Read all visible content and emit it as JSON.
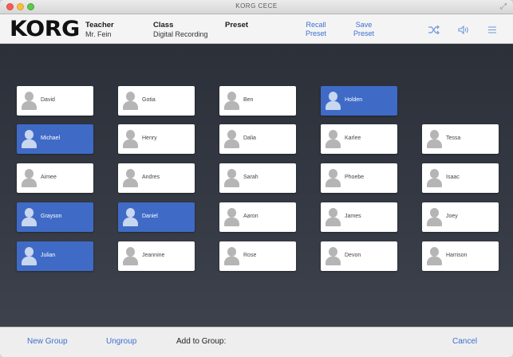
{
  "window": {
    "title": "KORG CECE"
  },
  "header": {
    "logo": "KORG",
    "teacher_label": "Teacher",
    "teacher_value": "Mr. Fein",
    "class_label": "Class",
    "class_value": "Digital Recording",
    "preset_label": "Preset",
    "recall_preset_line1": "Recall",
    "recall_preset_line2": "Preset",
    "save_preset_line1": "Save",
    "save_preset_line2": "Preset",
    "icons": [
      "shuffle-icon",
      "speaker-icon",
      "menu-icon"
    ]
  },
  "students": [
    {
      "name": "David",
      "selected": false
    },
    {
      "name": "Michael",
      "selected": true
    },
    {
      "name": "Aimee",
      "selected": false
    },
    {
      "name": "Grayson",
      "selected": true
    },
    {
      "name": "Julian",
      "selected": true
    },
    {
      "name": "Gotia",
      "selected": false
    },
    {
      "name": "Henry",
      "selected": false
    },
    {
      "name": "Andres",
      "selected": false
    },
    {
      "name": "Daniel",
      "selected": true
    },
    {
      "name": "Jeannine",
      "selected": false
    },
    {
      "name": "Ben",
      "selected": false
    },
    {
      "name": "Dalia",
      "selected": false
    },
    {
      "name": "Sarah",
      "selected": false
    },
    {
      "name": "Aaron",
      "selected": false
    },
    {
      "name": "Rose",
      "selected": false
    },
    {
      "name": "Holden",
      "selected": true
    },
    {
      "name": "Karlee",
      "selected": false
    },
    {
      "name": "Phoebe",
      "selected": false
    },
    {
      "name": "James",
      "selected": false
    },
    {
      "name": "Devon",
      "selected": false
    },
    {
      "name": "Tessa",
      "selected": false
    },
    {
      "name": "Isaac",
      "selected": false
    },
    {
      "name": "Joey",
      "selected": false
    },
    {
      "name": "Harrison",
      "selected": false
    }
  ],
  "footer": {
    "new_group": "New Group",
    "ungroup": "Ungroup",
    "add_to_group": "Add to Group:",
    "cancel": "Cancel"
  },
  "colors": {
    "accent": "#3f6bc7",
    "link": "#3d6fd1",
    "background": "#2b2f36"
  }
}
